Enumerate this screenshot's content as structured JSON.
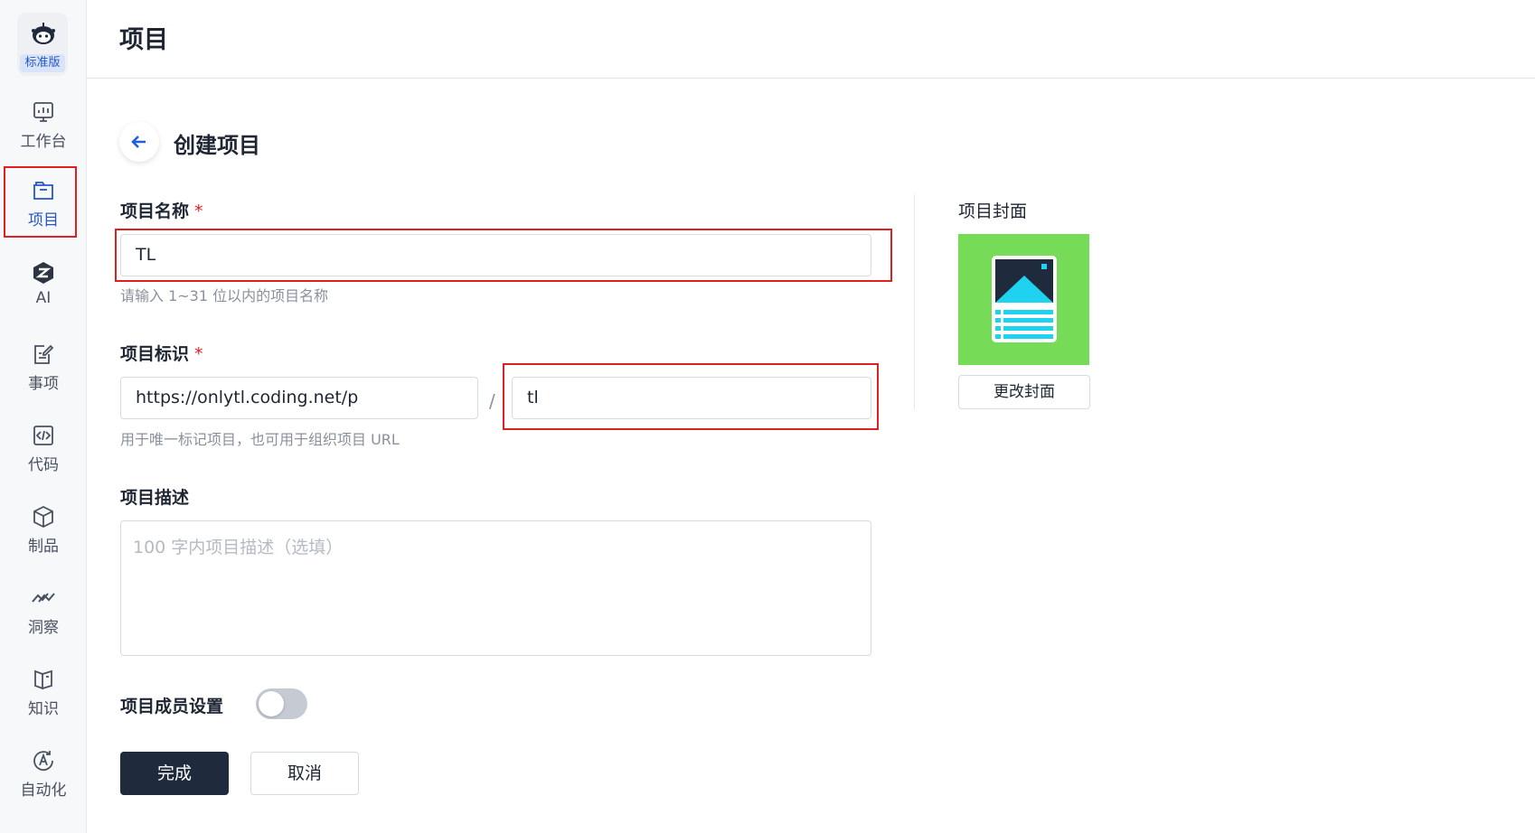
{
  "sidebar": {
    "edition": "标准版",
    "items": [
      {
        "label": "工作台",
        "icon": "monitor-chart-icon"
      },
      {
        "label": "项目",
        "icon": "folder-icon",
        "active": true
      },
      {
        "label": "AI",
        "icon": "ai-logo-icon"
      },
      {
        "label": "事项",
        "icon": "task-edit-icon"
      },
      {
        "label": "代码",
        "icon": "code-icon"
      },
      {
        "label": "制品",
        "icon": "package-cube-icon"
      },
      {
        "label": "洞察",
        "icon": "insight-chart-icon"
      },
      {
        "label": "知识",
        "icon": "book-icon"
      },
      {
        "label": "自动化",
        "icon": "automation-icon"
      }
    ]
  },
  "header": {
    "title": "项目"
  },
  "form": {
    "heading": "创建项目",
    "name": {
      "label": "项目名称",
      "required_mark": "*",
      "value": "TL",
      "hint": "请输入 1~31 位以内的项目名称"
    },
    "identifier": {
      "label": "项目标识",
      "required_mark": "*",
      "prefix": "https://onlytl.coding.net/p",
      "separator": "/",
      "value": "tl",
      "hint": "用于唯一标记项目，也可用于组织项目 URL"
    },
    "description": {
      "label": "项目描述",
      "placeholder": "100 字内项目描述（选填）",
      "value": ""
    },
    "members": {
      "label": "项目成员设置",
      "enabled": false
    },
    "submit_label": "完成",
    "cancel_label": "取消"
  },
  "cover": {
    "label": "项目封面",
    "change_label": "更改封面",
    "colors": {
      "background": "#76dc58",
      "accent": "#1fd3f0",
      "dark": "#1f2a3d"
    }
  },
  "colors": {
    "primary": "#1f2a3d",
    "accent": "#2457c5",
    "highlight": "#e02020"
  }
}
